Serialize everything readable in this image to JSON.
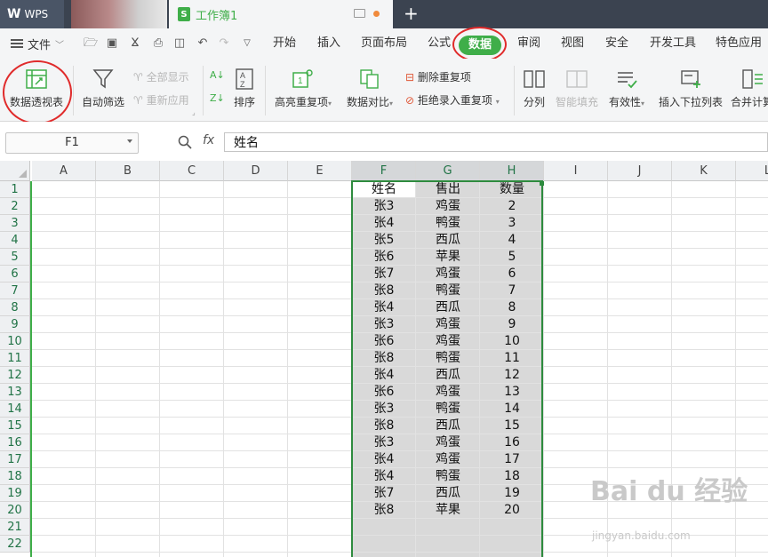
{
  "titlebar": {
    "app_label": "WPS",
    "doc_tab_title": "工作簿1",
    "new_tab": "+"
  },
  "menubar": {
    "file_label": "文件",
    "tabs": [
      "开始",
      "插入",
      "页面布局",
      "公式",
      "数据",
      "审阅",
      "视图",
      "安全",
      "开发工具",
      "特色应用"
    ],
    "active_tab": "数据"
  },
  "ribbon": {
    "pivot_table": "数据透视表",
    "auto_filter": "自动筛选",
    "show_all": "全部显示",
    "reapply": "重新应用",
    "sort": "排序",
    "highlight_duplicates": "高亮重复项",
    "data_compare": "数据对比",
    "remove_duplicates": "删除重复项",
    "reject_duplicates": "拒绝录入重复项",
    "split_column": "分列",
    "smart_fill": "智能填充",
    "validity": "有效性",
    "insert_dropdown": "插入下拉列表",
    "consolidate": "合并计算"
  },
  "formula_bar": {
    "name_box": "F1",
    "fx_label": "fx",
    "formula": "姓名"
  },
  "sheet": {
    "columns": [
      "A",
      "B",
      "C",
      "D",
      "E",
      "F",
      "G",
      "H",
      "I",
      "J",
      "K",
      "L"
    ],
    "selected_columns": [
      "F",
      "G",
      "H"
    ],
    "rows": [
      "1",
      "2",
      "3",
      "4",
      "5",
      "6",
      "7",
      "8",
      "9",
      "10",
      "11",
      "12",
      "13",
      "14",
      "15",
      "16",
      "17",
      "18",
      "19",
      "20",
      "21",
      "22"
    ],
    "headers": [
      "姓名",
      "售出",
      "数量"
    ],
    "data": [
      [
        "张3",
        "鸡蛋",
        "2"
      ],
      [
        "张4",
        "鸭蛋",
        "3"
      ],
      [
        "张5",
        "西瓜",
        "4"
      ],
      [
        "张6",
        "苹果",
        "5"
      ],
      [
        "张7",
        "鸡蛋",
        "6"
      ],
      [
        "张8",
        "鸭蛋",
        "7"
      ],
      [
        "张4",
        "西瓜",
        "8"
      ],
      [
        "张3",
        "鸡蛋",
        "9"
      ],
      [
        "张6",
        "鸡蛋",
        "10"
      ],
      [
        "张8",
        "鸭蛋",
        "11"
      ],
      [
        "张4",
        "西瓜",
        "12"
      ],
      [
        "张6",
        "鸡蛋",
        "13"
      ],
      [
        "张3",
        "鸭蛋",
        "14"
      ],
      [
        "张8",
        "西瓜",
        "15"
      ],
      [
        "张3",
        "鸡蛋",
        "16"
      ],
      [
        "张4",
        "鸡蛋",
        "17"
      ],
      [
        "张4",
        "鸭蛋",
        "18"
      ],
      [
        "张7",
        "西瓜",
        "19"
      ],
      [
        "张8",
        "苹果",
        "20"
      ]
    ]
  },
  "watermark": {
    "main": "Bai du 经验",
    "sub": "jingyan.baidu.com"
  },
  "colors": {
    "accent_green": "#3fae49",
    "highlight_red": "#e02b2b",
    "title_bg": "#3b4350"
  }
}
